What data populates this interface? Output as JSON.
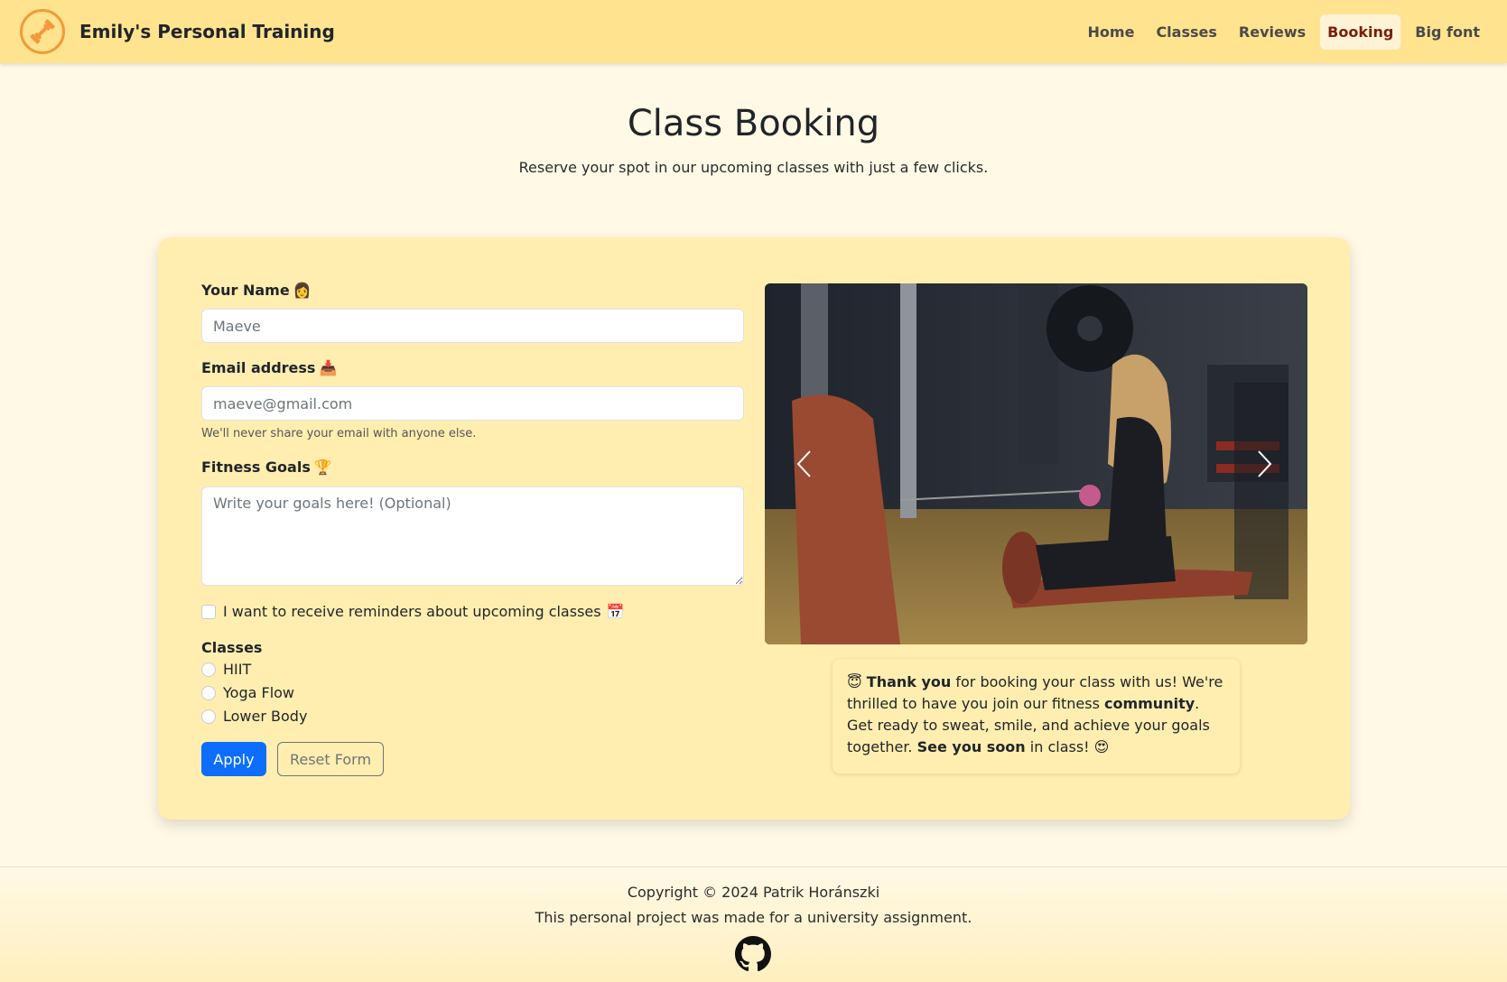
{
  "nav": {
    "brand": "Emily's Personal Training",
    "links": [
      "Home",
      "Classes",
      "Reviews",
      "Booking",
      "Big font"
    ],
    "active": "Booking"
  },
  "header": {
    "title": "Class Booking",
    "subtitle": "Reserve your spot in our upcoming classes with just a few clicks."
  },
  "form": {
    "name_label": "Your Name",
    "name_emoji": "👩",
    "name_placeholder": "Maeve",
    "email_label": "Email address",
    "email_emoji": "📥",
    "email_placeholder": "maeve@gmail.com",
    "email_help": "We'll never share your email with anyone else.",
    "goals_label": "Fitness Goals",
    "goals_emoji": "🏆",
    "goals_placeholder": "Write your goals here! (Optional)",
    "reminder_label": "I want to receive reminders about upcoming classes",
    "reminder_emoji": "📅",
    "classes_label": "Classes",
    "classes": [
      "HIIT",
      "Yoga Flow",
      "Lower Body"
    ],
    "apply_label": "Apply",
    "reset_label": "Reset Form"
  },
  "thank_you": {
    "emoji_start": "😇",
    "bold1": "Thank you",
    "text1": " for booking your class with us! We're thrilled to have you join our fitness ",
    "bold2": "community",
    "text2": ". Get ready to sweat, smile, and achieve your goals together. ",
    "bold3": "See you soon",
    "text3": " in class! ",
    "emoji_end": "😍"
  },
  "footer": {
    "copyright": "Copyright © 2024 Patrik Horánszki",
    "note": "This personal project was made for a university assignment."
  },
  "icons": {
    "logo": "dumbbell-icon",
    "carousel_prev": "chevron-left-icon",
    "carousel_next": "chevron-right-icon",
    "footer": "github-icon"
  },
  "colors": {
    "navbar": "#ffe38f",
    "page_bg": "#fff9e6",
    "card_bg": "#ffeeb0",
    "accent": "#f29a3a",
    "active_link": "#7a1f0a",
    "primary_button": "#0d6efd"
  }
}
